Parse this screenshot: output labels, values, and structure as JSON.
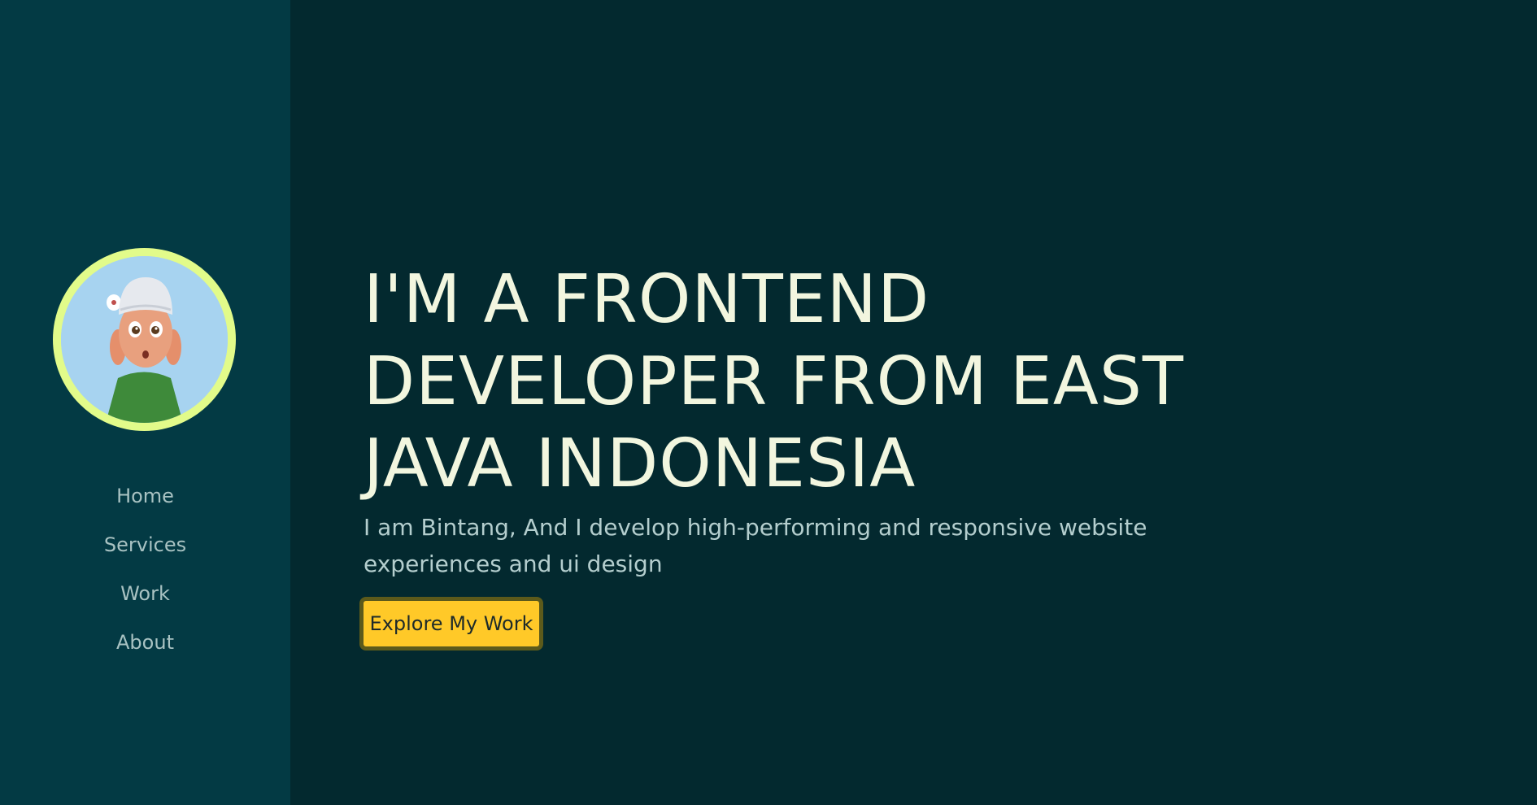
{
  "sidebar": {
    "avatar_alt": "profile avatar",
    "nav": [
      "Home",
      "Services",
      "Work",
      "About"
    ]
  },
  "hero": {
    "title_lines": [
      "I'M A FRONTEND",
      "DEVELOPER FROM EAST",
      "JAVA INDONESIA"
    ],
    "subtitle": "I am Bintang, And I develop high-performing and responsive website experiences and ui design",
    "cta_label": "Explore My Work"
  },
  "colors": {
    "background": "#03292F",
    "sidebar": "#033A44",
    "avatar_ring": "#E2FB8A",
    "accent": "#FFC928",
    "title": "#F2F6DF"
  }
}
